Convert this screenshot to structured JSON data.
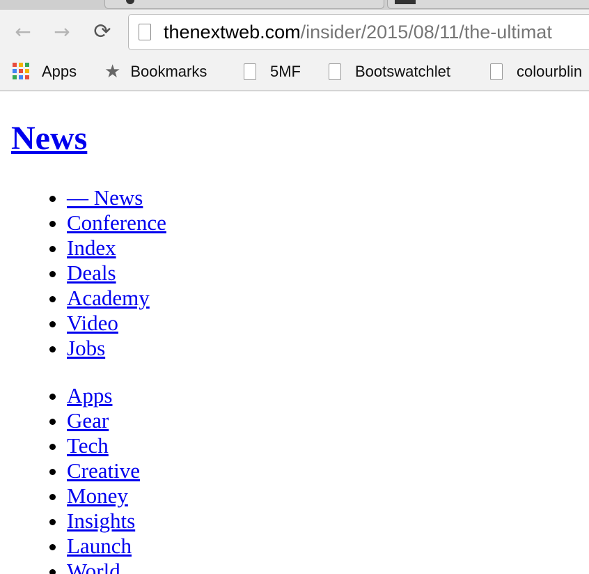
{
  "browser": {
    "url_host": "thenextweb.com",
    "url_path": "/insider/2015/08/11/the-ultimat",
    "bookmarks": [
      {
        "label": "Apps",
        "icon": "apps-grid-icon"
      },
      {
        "label": "Bookmarks",
        "icon": "star-icon"
      },
      {
        "label": "5MF",
        "icon": "page-icon"
      },
      {
        "label": "Bootswatchlet",
        "icon": "page-icon"
      },
      {
        "label": "colourblin",
        "icon": "page-icon"
      }
    ]
  },
  "page": {
    "heading": "News",
    "primary_nav": [
      "— News",
      "Conference",
      "Index",
      "Deals",
      "Academy",
      "Video",
      "Jobs"
    ],
    "section_nav": [
      "Apps",
      "Gear",
      "Tech",
      "Creative",
      "Money",
      "Insights",
      "Launch",
      "World"
    ]
  },
  "colors": {
    "link": "#0000ee",
    "chrome_bg": "#f2f2f2"
  }
}
